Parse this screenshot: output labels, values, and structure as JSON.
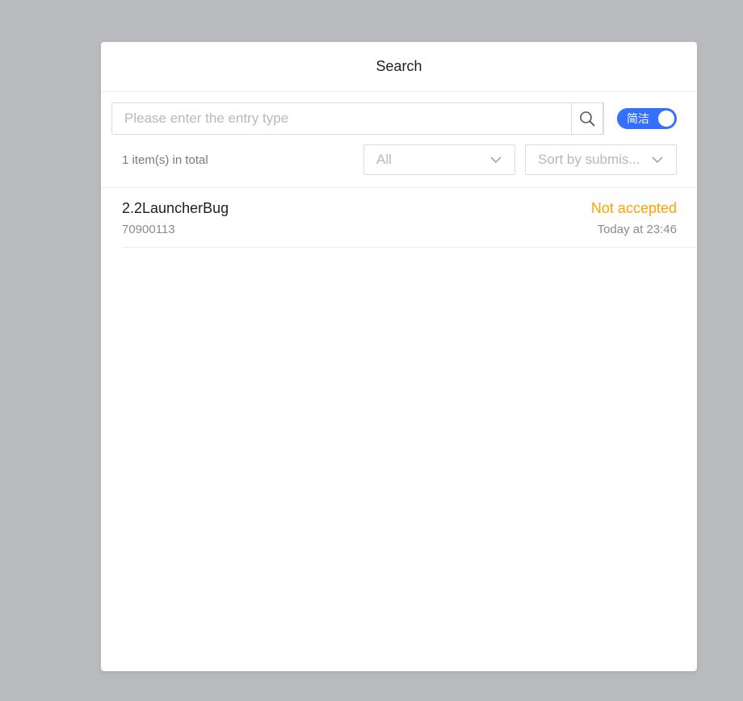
{
  "dialog": {
    "title": "Search"
  },
  "search": {
    "placeholder": "Please enter the entry type",
    "value": "",
    "button_icon": "search-icon"
  },
  "toggle": {
    "label": "简洁",
    "on": true,
    "color": "#3370ff"
  },
  "filters": {
    "total_text": "1 item(s) in total",
    "type_select": {
      "value": "All",
      "icon": "chevron-down-icon"
    },
    "sort_select": {
      "value": "Sort by submis...",
      "icon": "chevron-down-icon"
    }
  },
  "items": [
    {
      "name": "2.2LauncherBug",
      "id": "70900113",
      "status": "Not accepted",
      "status_color": "#ffa200",
      "time": "Today at 23:46"
    }
  ]
}
